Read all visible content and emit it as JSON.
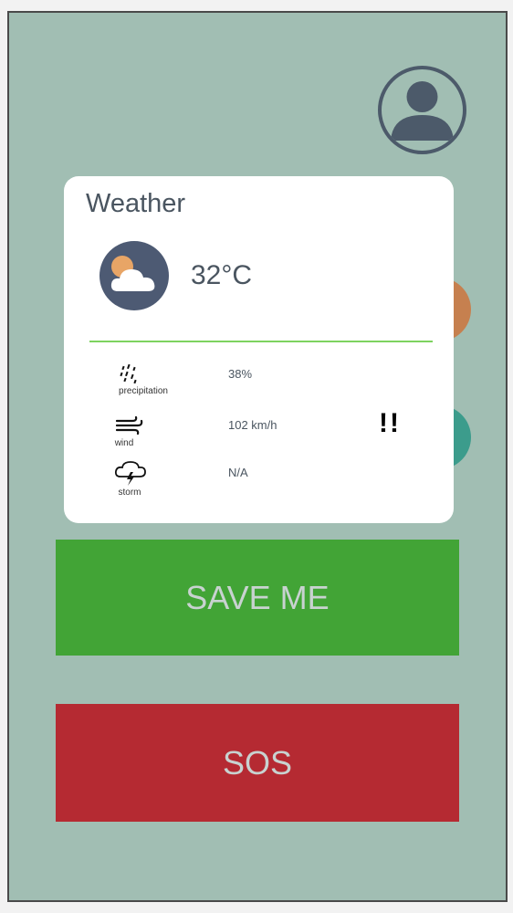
{
  "weather": {
    "title": "Weather",
    "temperature": "32°C",
    "rows": [
      {
        "icon": "precipitation-icon",
        "label": "precipitation",
        "value": "38%"
      },
      {
        "icon": "wind-icon",
        "label": "wind",
        "value": "102 km/h"
      },
      {
        "icon": "storm-icon",
        "label": "storm",
        "value": "N/A"
      }
    ],
    "alert": "!!"
  },
  "buttons": {
    "save": "SAVE ME",
    "sos": "SOS"
  },
  "colors": {
    "background": "#a1beb3",
    "save": "#42a436",
    "sos": "#b52a32",
    "divider": "#7dd35f"
  }
}
